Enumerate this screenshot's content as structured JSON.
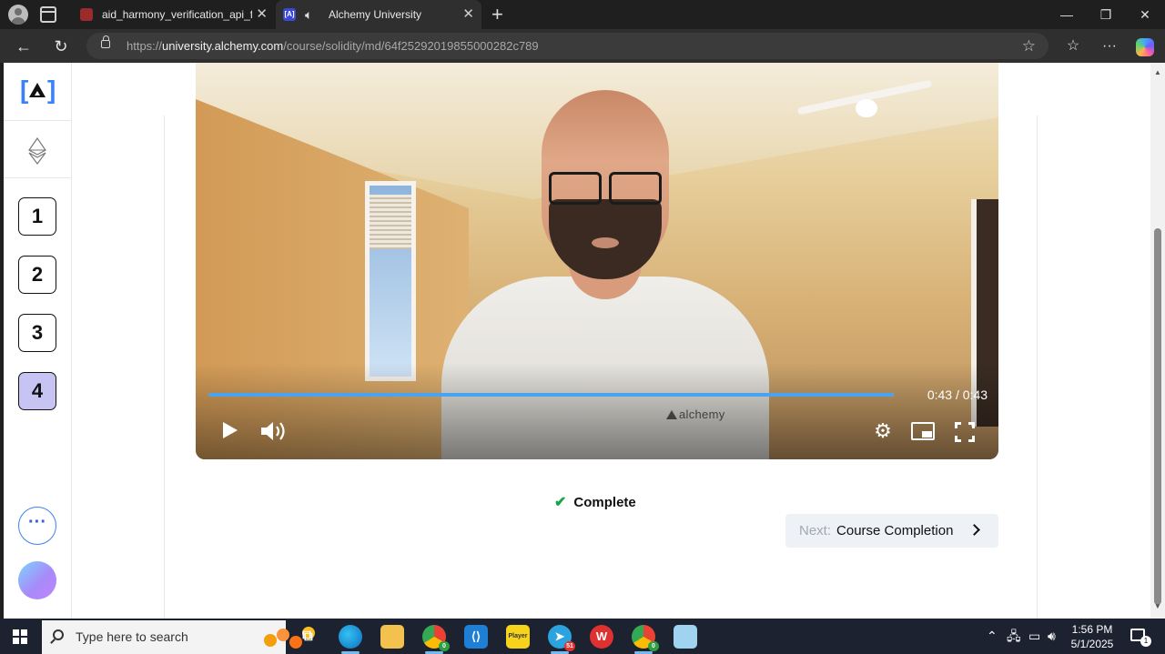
{
  "browser": {
    "tabs": [
      {
        "title": "aid_harmony_verification_api_field",
        "favicon": "tab-favicon-icon",
        "active": false
      },
      {
        "title": "Alchemy University",
        "favicon": "alchemy-favicon-icon",
        "active": true,
        "audio": true
      }
    ],
    "address": {
      "prefix": "https://",
      "domain": "university.alchemy.com",
      "path": "/course/solidity/md/64f25292019855000282c789"
    }
  },
  "sidebar": {
    "steps": [
      {
        "number": "1",
        "active": false
      },
      {
        "number": "2",
        "active": false
      },
      {
        "number": "3",
        "active": false
      },
      {
        "number": "4",
        "active": true
      }
    ],
    "more_label": "···"
  },
  "video": {
    "time": "0:43 / 0:43",
    "progress": 1.0,
    "shirt_text": "alchemy"
  },
  "lesson": {
    "complete_label": "Complete",
    "next_prefix": "Next:",
    "next_title": "Course Completion"
  },
  "taskbar": {
    "search_placeholder": "Type here to search",
    "time": "1:56 PM",
    "date": "5/1/2025",
    "telegram_badge": "51",
    "chrome_badge": "0",
    "chrome2_badge": "0",
    "notification_count": "1",
    "apps": [
      "task-view",
      "edge",
      "file-explorer",
      "chrome",
      "vscode",
      "player",
      "telegram",
      "wps",
      "chrome-profile",
      "notepad"
    ]
  },
  "colors": {
    "accent": "#3b82f6",
    "active_step": "#c7c4f4",
    "check": "#16a34a",
    "progress": "#4aa3f0"
  }
}
